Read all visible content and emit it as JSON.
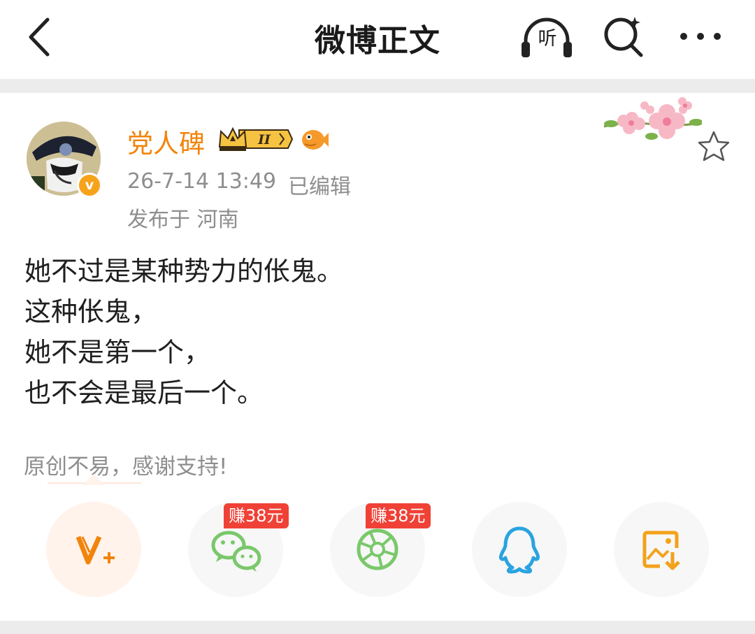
{
  "header": {
    "title": "微博正文",
    "listen_label": "听"
  },
  "post": {
    "username": "党人碑",
    "badge_level": "II",
    "verified_mark": "v",
    "time": "26-7-14 13:49",
    "edited": "已编辑",
    "location": "发布于 河南",
    "content_lines": [
      "她不过是某种势力的伥鬼。",
      "这种伥鬼，",
      "她不是第一个，",
      "也不会是最后一个。"
    ]
  },
  "support": {
    "text": "原创不易，感谢支持!"
  },
  "share": {
    "earn_label": "赚38元",
    "buttons": [
      {
        "icon": "v-plus-icon"
      },
      {
        "icon": "wechat-icon",
        "earn": true
      },
      {
        "icon": "moments-icon",
        "earn": true
      },
      {
        "icon": "qq-icon"
      },
      {
        "icon": "save-image-icon"
      }
    ]
  },
  "colors": {
    "accent": "#f2840c",
    "earn_tag": "#f04136",
    "wechat_green": "#7ac86b",
    "qq_blue": "#2aa3e0"
  }
}
